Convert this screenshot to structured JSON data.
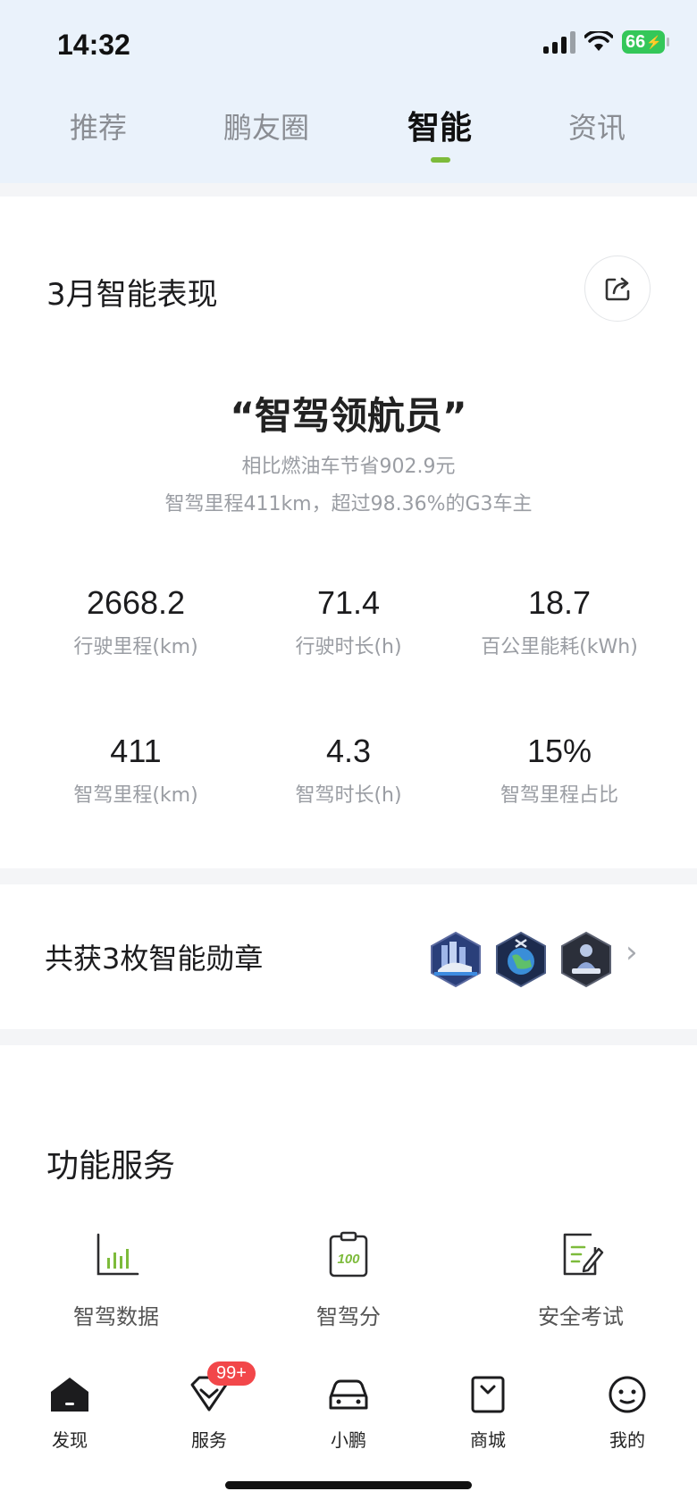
{
  "status_bar": {
    "time": "14:32",
    "battery": "66"
  },
  "tabs": [
    {
      "label": "推荐"
    },
    {
      "label": "鹏友圈"
    },
    {
      "label": "智能"
    },
    {
      "label": "资讯"
    }
  ],
  "performance": {
    "title": "3月智能表现",
    "badge_title": "“智驾领航员”",
    "saving_line": "相比燃油车节省902.9元",
    "mileage_line": "智驾里程411km，超过98.36%的G3车主",
    "stats": [
      {
        "value": "2668.2",
        "label": "行驶里程(km)"
      },
      {
        "value": "71.4",
        "label": "行驶时长(h)"
      },
      {
        "value": "18.7",
        "label": "百公里能耗(kWh)"
      },
      {
        "value": "411",
        "label": "智驾里程(km)"
      },
      {
        "value": "4.3",
        "label": "智驾时长(h)"
      },
      {
        "value": "15%",
        "label": "智驾里程占比"
      }
    ]
  },
  "medals": {
    "title": "共获3枚智能勋章"
  },
  "services": {
    "title": "功能服务",
    "items": [
      {
        "label": "智驾数据",
        "icon": "bar-chart-icon"
      },
      {
        "label": "智驾分",
        "icon": "score-clipboard-icon",
        "icon_text": "100"
      },
      {
        "label": "安全考试",
        "icon": "exam-edit-icon"
      }
    ]
  },
  "bottom_nav": {
    "items": [
      {
        "label": "发现",
        "icon": "home-icon"
      },
      {
        "label": "服务",
        "icon": "service-icon",
        "badge": "99+"
      },
      {
        "label": "小鹏",
        "icon": "car-icon"
      },
      {
        "label": "商城",
        "icon": "shop-bag-icon"
      },
      {
        "label": "我的",
        "icon": "profile-icon"
      }
    ]
  },
  "colors": {
    "accent": "#7dbb3b",
    "badge_red": "#f2474a",
    "battery_green": "#34c759"
  }
}
